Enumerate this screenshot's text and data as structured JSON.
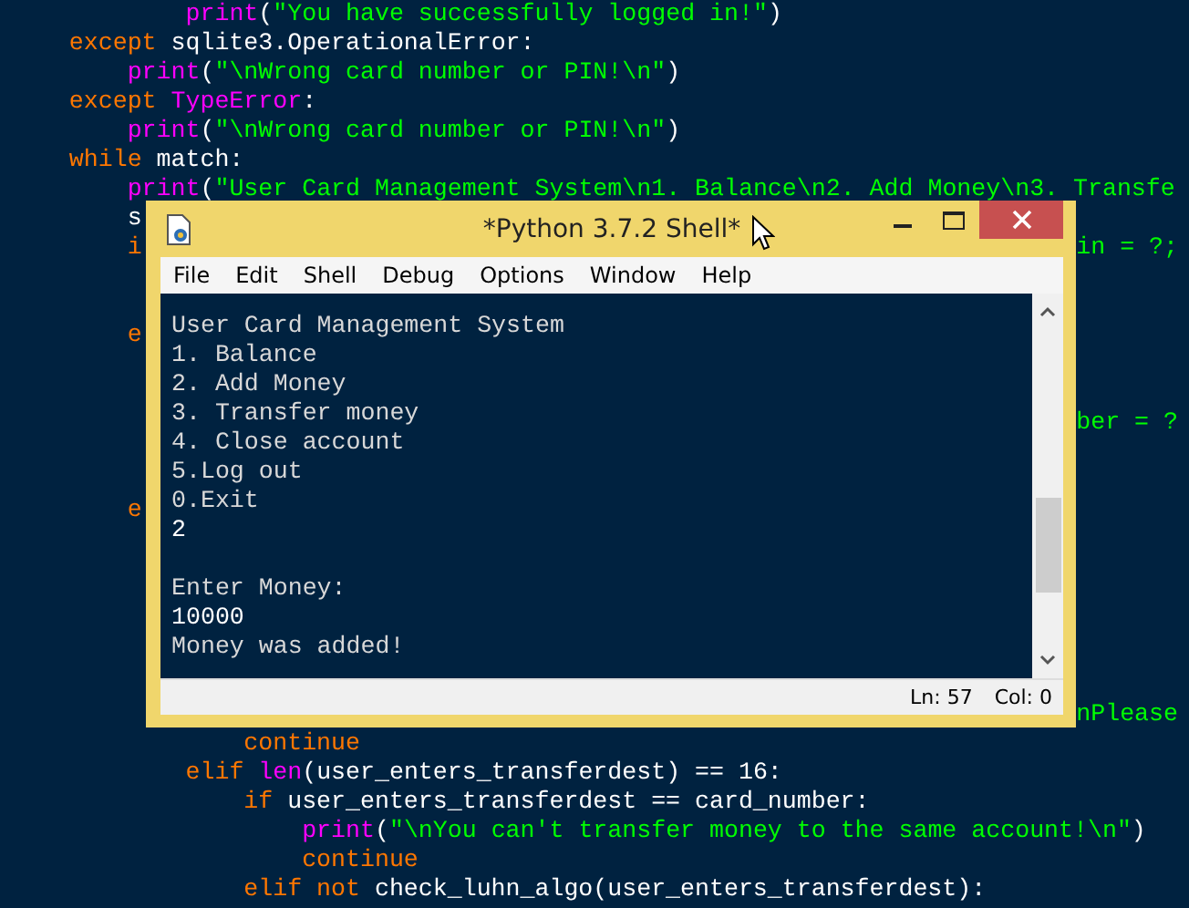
{
  "editor": {
    "lines": [
      {
        "children": [
          {
            "children": [
              {
                "children": [
                  {
                    "kind": "code",
                    "tokens": [
                      {
                        "kind": "builtin",
                        "text": "print"
                      },
                      {
                        "kind": "plain",
                        "text": "("
                      },
                      {
                        "kind": "string",
                        "text": "\"You have successfully logged in!\""
                      },
                      {
                        "kind": "plain",
                        "text": ")"
                      }
                    ]
                  }
                ]
              }
            ]
          }
        ]
      },
      {
        "children": [
          {
            "kind": "code",
            "tokens": [
              {
                "kind": "keyword",
                "text": "except"
              },
              {
                "kind": "plain",
                "text": "sqlite3.OperationalError:"
              }
            ],
            "children": [
              {
                "kind": "code",
                "tokens": [
                  {
                    "kind": "builtin",
                    "text": "print"
                  },
                  {
                    "kind": "plain",
                    "text": "("
                  },
                  {
                    "kind": "string",
                    "text": "\"\\nWrong card number or PIN!\\n\""
                  },
                  {
                    "kind": "plain",
                    "text": ")"
                  }
                ]
              }
            ]
          },
          {
            "kind": "code",
            "tokens": [
              {
                "kind": "keyword",
                "text": "except"
              },
              {
                "kind": "builtin",
                "text": "TypeError"
              },
              {
                "kind": "plain",
                "text": ":"
              }
            ],
            "children": [
              {
                "kind": "code",
                "tokens": [
                  {
                    "kind": "builtin",
                    "text": "print"
                  },
                  {
                    "kind": "plain",
                    "text": "("
                  },
                  {
                    "kind": "string",
                    "text": "\"\\nWrong card number or PIN!\\n\""
                  },
                  {
                    "kind": "plain",
                    "text": ")"
                  }
                ]
              }
            ]
          },
          {
            "kind": "code",
            "tokens": [
              {
                "kind": "keyword",
                "text": "while"
              },
              {
                "kind": "plain",
                "text": "match:"
              }
            ],
            "children": [
              {
                "kind": "code",
                "tokens": [
                  {
                    "kind": "builtin",
                    "text": "print"
                  },
                  {
                    "kind": "plain",
                    "text": "("
                  },
                  {
                    "kind": "string",
                    "text": "\"User Card Management System\\n1. Balance\\n2. Add Money\\n3. Transfe"
                  }
                ]
              },
              {
                "kind": "code",
                "tokens": [
                  {
                    "kind": "plain",
                    "text": "s"
                  }
                ]
              },
              {
                "kind": "code",
                "tokens": [
                  {
                    "kind": "keyword",
                    "text": "i"
                  }
                ],
                "right": {
                  "kind": "string",
                  "text": "in = ?;"
                }
              },
              {
                "kind": "blank"
              },
              {
                "kind": "blank"
              },
              {
                "kind": "code",
                "tokens": [
                  {
                    "kind": "keyword",
                    "text": "e"
                  }
                ]
              },
              {
                "kind": "blank"
              },
              {
                "kind": "blank"
              },
              {
                "kind": "blank",
                "right": {
                  "kind": "string",
                  "text": "ber = ?"
                }
              },
              {
                "kind": "blank"
              },
              {
                "kind": "blank"
              },
              {
                "kind": "code",
                "tokens": [
                  {
                    "kind": "keyword",
                    "text": "e"
                  }
                ]
              },
              {
                "kind": "blank"
              },
              {
                "kind": "blank"
              },
              {
                "kind": "blank"
              },
              {
                "kind": "blank"
              },
              {
                "kind": "blank"
              },
              {
                "kind": "blank"
              },
              {
                "kind": "blank",
                "right": {
                  "kind": "string",
                  "text": "nPlease"
                }
              },
              {
                "children": [
                  {
                    "children": [
                      {
                        "kind": "code",
                        "tokens": [
                          {
                            "kind": "keyword",
                            "text": "continue"
                          }
                        ]
                      }
                    ]
                  },
                  {
                    "kind": "code",
                    "tokens": [
                      {
                        "kind": "keyword",
                        "text": "elif"
                      },
                      {
                        "kind": "builtin",
                        "text": "len"
                      },
                      {
                        "kind": "plain",
                        "text": "(user_enters_transferdest) == 16:"
                      }
                    ],
                    "children": [
                      {
                        "kind": "code",
                        "tokens": [
                          {
                            "kind": "keyword",
                            "text": "if"
                          },
                          {
                            "kind": "plain",
                            "text": "user_enters_transferdest == card_number:"
                          }
                        ],
                        "children": [
                          {
                            "kind": "code",
                            "tokens": [
                              {
                                "kind": "builtin",
                                "text": "print"
                              },
                              {
                                "kind": "plain",
                                "text": "("
                              },
                              {
                                "kind": "string",
                                "text": "\"\\nYou can't transfer money to the same account!\\n\""
                              },
                              {
                                "kind": "plain",
                                "text": ")"
                              }
                            ]
                          },
                          {
                            "kind": "code",
                            "tokens": [
                              {
                                "kind": "keyword",
                                "text": "continue"
                              }
                            ]
                          }
                        ]
                      },
                      {
                        "kind": "code",
                        "tokens": [
                          {
                            "kind": "keyword",
                            "text": "elif"
                          },
                          {
                            "kind": "keyword",
                            "text": "not"
                          },
                          {
                            "kind": "plain",
                            "text": "check_luhn_algo(user_enters_transferdest):"
                          }
                        ]
                      }
                    ]
                  }
                ]
              }
            ]
          }
        ]
      }
    ]
  },
  "window": {
    "title": "*Python 3.7.2 Shell*",
    "menu": [
      {
        "label": "File"
      },
      {
        "label": "Edit"
      },
      {
        "label": "Shell"
      },
      {
        "label": "Debug"
      },
      {
        "label": "Options"
      },
      {
        "label": "Window"
      },
      {
        "label": "Help"
      }
    ],
    "shell_lines": [
      {
        "kind": "output",
        "text": "User Card Management System"
      },
      {
        "kind": "output",
        "text": "1. Balance"
      },
      {
        "kind": "output",
        "text": "2. Add Money"
      },
      {
        "kind": "output",
        "text": "3. Transfer money"
      },
      {
        "kind": "output",
        "text": "4. Close account"
      },
      {
        "kind": "output",
        "text": "5.Log out"
      },
      {
        "kind": "output",
        "text": "0.Exit"
      },
      {
        "kind": "input",
        "text": "2"
      },
      {
        "kind": "blank"
      },
      {
        "kind": "output",
        "text": "Enter Money:"
      },
      {
        "kind": "input",
        "text": "10000"
      },
      {
        "kind": "output",
        "text": "Money was added!"
      }
    ],
    "status_bar": {
      "line": "Ln: 57",
      "column": "Col: 0"
    }
  }
}
